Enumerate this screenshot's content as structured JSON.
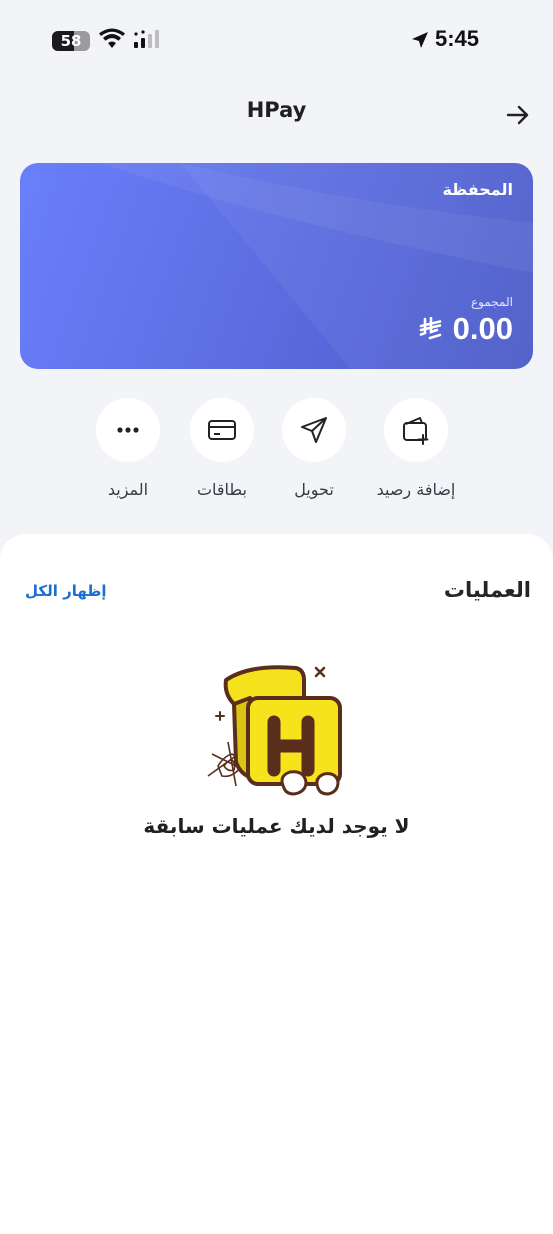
{
  "status_bar": {
    "battery_level": "58",
    "time": "5:45"
  },
  "header": {
    "title": "HPay",
    "back_icon": "arrow-right-icon"
  },
  "wallet_card": {
    "title": "المحفظة",
    "total_label": "المجموع",
    "amount": "0.00",
    "currency_icon": "saudi-riyal-icon",
    "colors": {
      "start": "#6a7ffb",
      "end": "#4b5ac8"
    }
  },
  "actions": [
    {
      "label": "إضافة رصيد",
      "icon": "wallet-add-icon"
    },
    {
      "label": "تحويل",
      "icon": "send-icon"
    },
    {
      "label": "بطاقات",
      "icon": "card-icon"
    },
    {
      "label": "المزيد",
      "icon": "more-icon"
    }
  ],
  "transactions": {
    "title": "العمليات",
    "show_all": "إظهار الكل",
    "empty_message": "لا يوجد لديك عمليات سابقة",
    "empty_icon": "hpay-mascot-icon"
  },
  "colors": {
    "accent": "#1a6fd0",
    "background": "#f3f4f8"
  }
}
